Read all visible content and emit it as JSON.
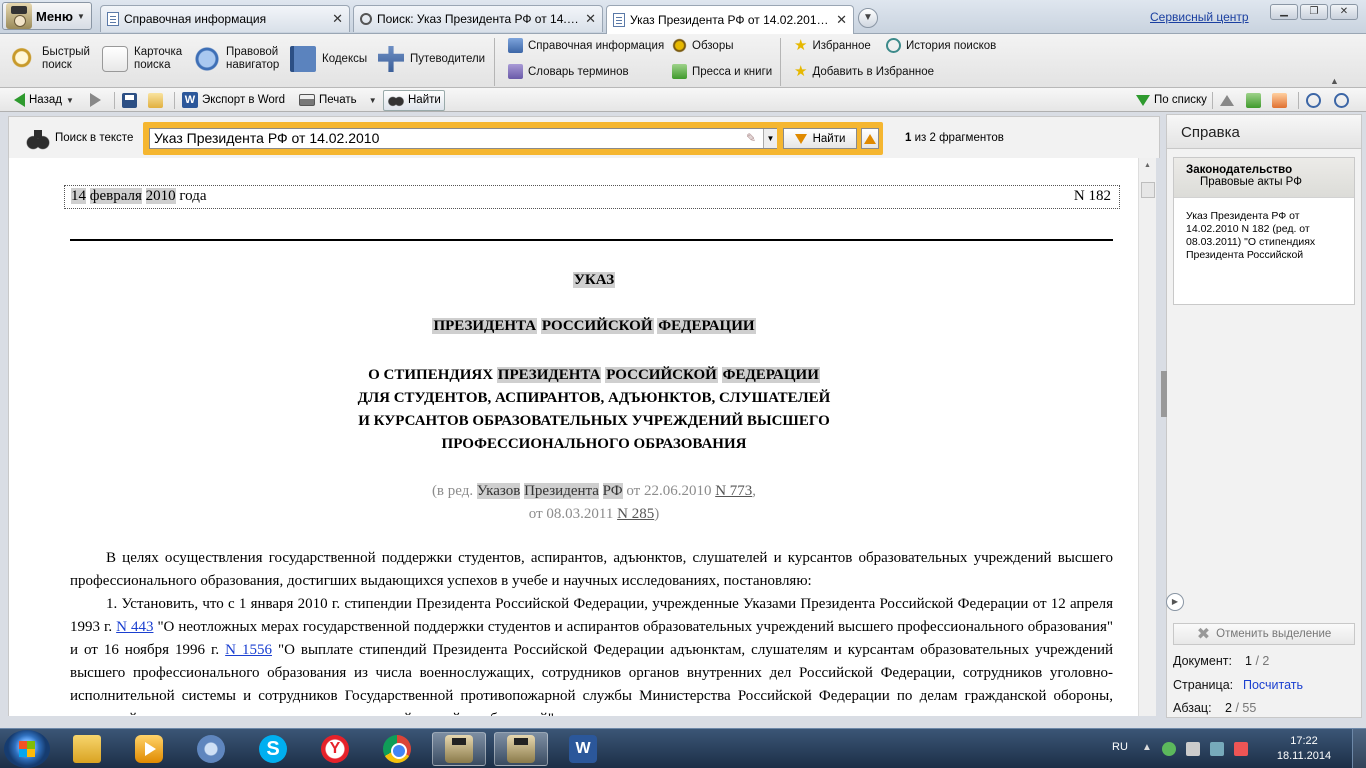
{
  "titlebar": {
    "menu_label": "Меню",
    "tabs": [
      {
        "label": "Справочная информация"
      },
      {
        "label": "Поиск: Указ Президента РФ от 14.02..."
      },
      {
        "label": "Указ Президента РФ от 14.02.2010 N..."
      }
    ],
    "service_link": "Сервисный центр"
  },
  "toolbar": {
    "quick_search": "Быстрый поиск",
    "card_search": "Карточка поиска",
    "legal_nav": "Правовой навигатор",
    "codexes": "Кодексы",
    "guides": "Путеводители",
    "reference_info": "Справочная информация",
    "terms": "Словарь терминов",
    "reviews": "Обзоры",
    "press": "Пресса и книги",
    "favorites": "Избранное",
    "add_favorites": "Добавить в Избранное",
    "search_history": "История поисков"
  },
  "navbar": {
    "back": "Назад",
    "export_word": "Экспорт в Word",
    "print": "Печать",
    "find": "Найти",
    "by_list": "По списку"
  },
  "searchpanel": {
    "label": "Поиск в тексте",
    "query": "Указ Президента РФ от 14.02.2010",
    "find_button": "Найти",
    "count_current": "1",
    "count_rest": "из 2 фрагментов"
  },
  "document": {
    "date_day": "14",
    "date_month": "февраля",
    "date_year": "2010",
    "date_suffix": "года",
    "number": "N 182",
    "type": "УКАЗ",
    "issuer": {
      "w1": "ПРЕЗИДЕНТА",
      "w2": "РОССИЙСКОЙ",
      "w3": "ФЕДЕРАЦИИ"
    },
    "title_l1_prefix": "О СТИПЕНДИЯХ",
    "title_l2": "ДЛЯ СТУДЕНТОВ, АСПИРАНТОВ, АДЪЮНКТОВ, СЛУШАТЕЛЕЙ",
    "title_l3": "И КУРСАНТОВ ОБРАЗОВАТЕЛЬНЫХ УЧРЕЖДЕНИЙ ВЫСШЕГО",
    "title_l4": "ПРОФЕССИОНАЛЬНОГО ОБРАЗОВАНИЯ",
    "edition": {
      "open": "(в ред.",
      "w1": "Указов",
      "w2": "Президента",
      "w3": "РФ",
      "from1": "от 22.06.2010",
      "link1": "N 773",
      "from2": "от 08.03.2011",
      "link2": "N 285",
      "close": ")"
    },
    "para1": "В целях осуществления государственной поддержки студентов, аспирантов, адъюнктов, слушателей и курсантов образовательных учреждений высшего профессионального образования, достигших выдающихся успехов в учебе и научных исследованиях, постановляю:",
    "para2_a": "1. Установить, что с 1 января 2010 г. стипендии Президента Российской Федерации, учрежденные Указами Президента Российской Федерации от 12 апреля 1993 г.",
    "para2_link1": "N 443",
    "para2_b": "\"О неотложных мерах государственной поддержки студентов и аспирантов образовательных учреждений высшего профессионального образования\" и от 16 ноября 1996 г.",
    "para2_link2": "N 1556",
    "para2_c": "\"О выплате стипендий Президента Российской Федерации адъюнктам, слушателям и курсантам образовательных учреждений высшего профессионального образования из числа военнослужащих, сотрудников органов внутренних дел Российской Федерации, сотрудников уголовно-исполнительной системы и сотрудников Государственной противопожарной службы Министерства Российской Федерации по делам гражданской обороны, чрезвычайным ситуациям и ликвидации последствий стихийных бедствий\""
  },
  "rightpanel": {
    "title": "Справка",
    "card_category": "Законодательство",
    "card_subcategory": "Правовые акты РФ",
    "card_text": "Указ Президента РФ от 14.02.2010 N 182 (ред. от 08.03.2011) \"О стипендиях Президента Российской",
    "cancel_selection": "Отменить выделение",
    "doc_label": "Документ:",
    "doc_current": "1",
    "doc_total": "/ 2",
    "page_label": "Страница:",
    "page_link": "Посчитать",
    "para_label": "Абзац:",
    "para_current": "2",
    "para_total": "/ 55"
  },
  "taskbar": {
    "lang": "RU",
    "time": "17:22",
    "date": "18.11.2014"
  }
}
